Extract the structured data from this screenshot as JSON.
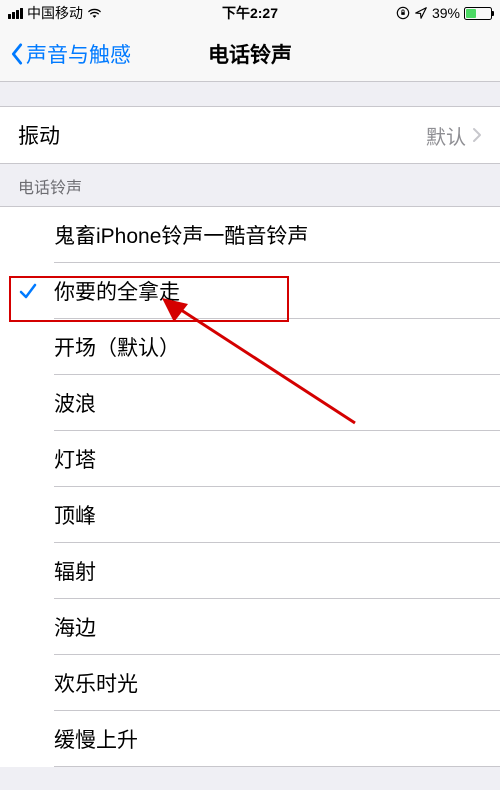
{
  "status": {
    "carrier": "中国移动",
    "time": "下午2:27",
    "battery_pct": "39%",
    "battery_fill_pct": 39
  },
  "nav": {
    "back_label": "声音与触感",
    "title": "电话铃声"
  },
  "vibration": {
    "label": "振动",
    "value": "默认"
  },
  "section": {
    "header": "电话铃声"
  },
  "ringtones": [
    {
      "label": "鬼畜iPhone铃声一酷音铃声",
      "selected": false
    },
    {
      "label": "你要的全拿走",
      "selected": true
    },
    {
      "label": "开场（默认）",
      "selected": false
    },
    {
      "label": "波浪",
      "selected": false
    },
    {
      "label": "灯塔",
      "selected": false
    },
    {
      "label": "顶峰",
      "selected": false
    },
    {
      "label": "辐射",
      "selected": false
    },
    {
      "label": "海边",
      "selected": false
    },
    {
      "label": "欢乐时光",
      "selected": false
    },
    {
      "label": "缓慢上升",
      "selected": false
    }
  ]
}
